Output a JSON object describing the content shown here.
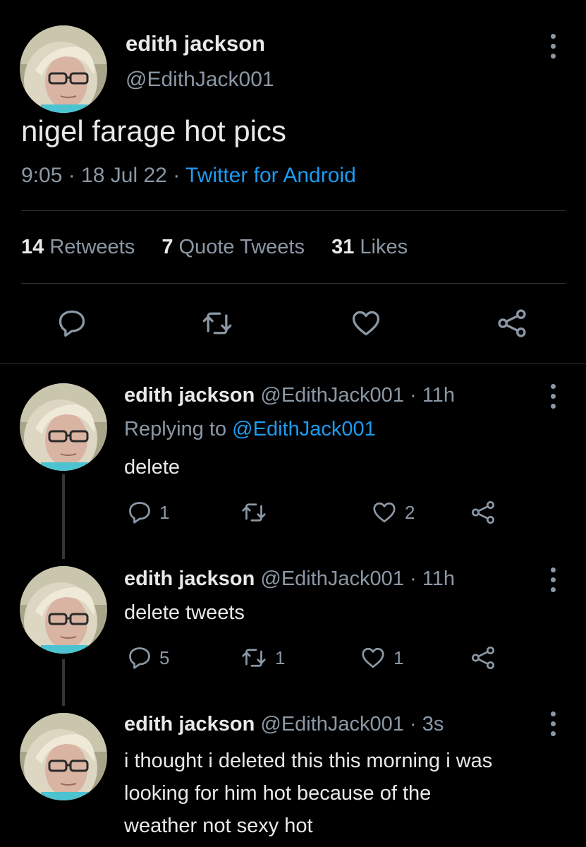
{
  "main_tweet": {
    "display_name": "edith jackson",
    "handle": "@EdithJack001",
    "text": "nigel farage hot pics",
    "time": "9:05",
    "date": "18 Jul 22",
    "source": "Twitter for Android",
    "stats": {
      "retweets_count": "14",
      "retweets_label": "Retweets",
      "quotes_count": "7",
      "quotes_label": "Quote Tweets",
      "likes_count": "31",
      "likes_label": "Likes"
    }
  },
  "separator": "·",
  "replies": [
    {
      "display_name": "edith jackson",
      "handle": "@EdithJack001",
      "age": "11h",
      "replying_prefix": "Replying to",
      "replying_to": "@EdithJack001",
      "text": "delete",
      "reply_count": "1",
      "retweet_count": "",
      "like_count": "2"
    },
    {
      "display_name": "edith jackson",
      "handle": "@EdithJack001",
      "age": "11h",
      "text": "delete tweets",
      "reply_count": "5",
      "retweet_count": "1",
      "like_count": "1"
    },
    {
      "display_name": "edith jackson",
      "handle": "@EdithJack001",
      "age": "3s",
      "text_lines": [
        "i thought i deleted this this morning i was",
        "looking for him hot because of the",
        "weather not sexy hot"
      ]
    }
  ],
  "icons": [
    "reply-icon",
    "retweet-icon",
    "like-icon",
    "share-icon",
    "more-icon",
    "avatar"
  ],
  "colors": {
    "background": "#000000",
    "text": "#e7e9ea",
    "muted": "#8b98a5",
    "link": "#1d9bf0",
    "divider": "#2f3336"
  }
}
